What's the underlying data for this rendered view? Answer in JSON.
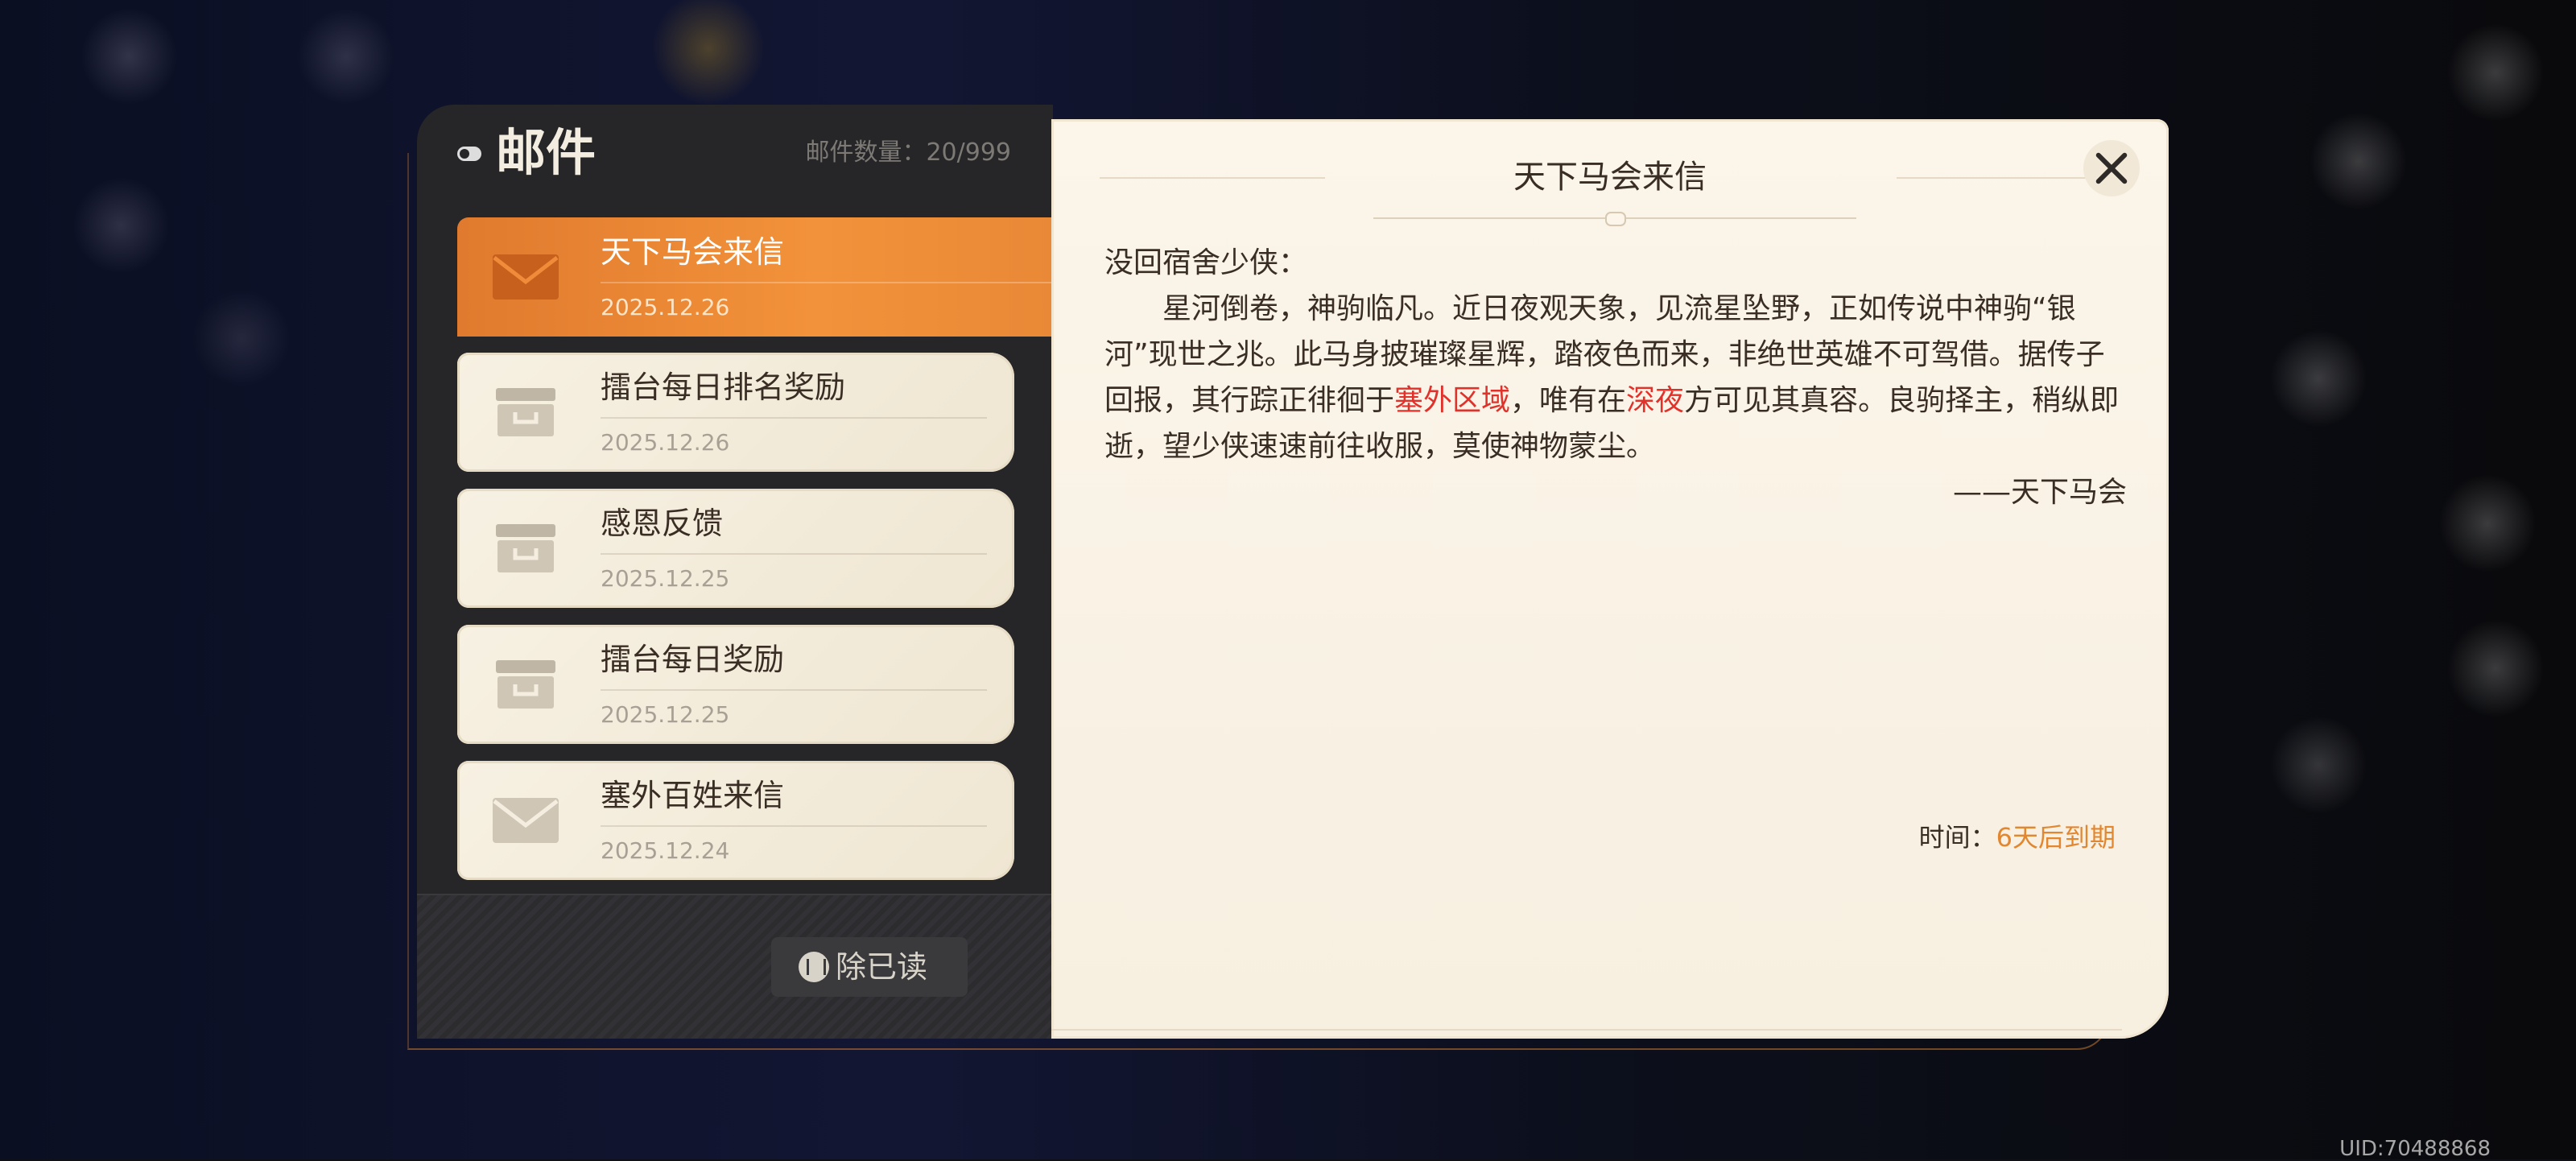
{
  "panel": {
    "title": "邮件",
    "mail_count": "邮件数量：20/999"
  },
  "mail_list": [
    {
      "title": "天下马会来信",
      "date": "2025.12.26",
      "icon": "envelope-icon",
      "selected": true
    },
    {
      "title": "擂台每日排名奖励",
      "date": "2025.12.26",
      "icon": "chest-icon",
      "selected": false
    },
    {
      "title": "感恩反馈",
      "date": "2025.12.25",
      "icon": "chest-icon",
      "selected": false
    },
    {
      "title": "擂台每日奖励",
      "date": "2025.12.25",
      "icon": "chest-icon",
      "selected": false
    },
    {
      "title": "塞外百姓来信",
      "date": "2025.12.24",
      "icon": "envelope-icon",
      "selected": false
    }
  ],
  "footer": {
    "delete_read_label": "除已读"
  },
  "detail": {
    "title": "天下马会来信",
    "greeting": "没回宿舍少侠：",
    "body_part1": "星河倒卷，神驹临凡。近日夜观天象，见流星坠野，正如传说中神驹“银河”现世之兆。此马身披璀璨星辉，踏夜色而来，非绝世英雄不可驾借。据传子回报，其行踪正徘徊于",
    "body_hl1": "塞外区域",
    "body_part2": "，唯有在",
    "body_hl2": "深夜",
    "body_part3": "方可见其真容。良驹择主，稍纵即逝，望少侠速速前往收服，莫使神物蒙尘。",
    "signature": "——天下马会",
    "time_label": "时间：",
    "time_value": "6天后到期"
  },
  "uid": "UID:70488868",
  "colors": {
    "accent_orange": "#e07a2e",
    "highlight_red": "#e0312a",
    "expiry_orange": "#e2862f"
  }
}
